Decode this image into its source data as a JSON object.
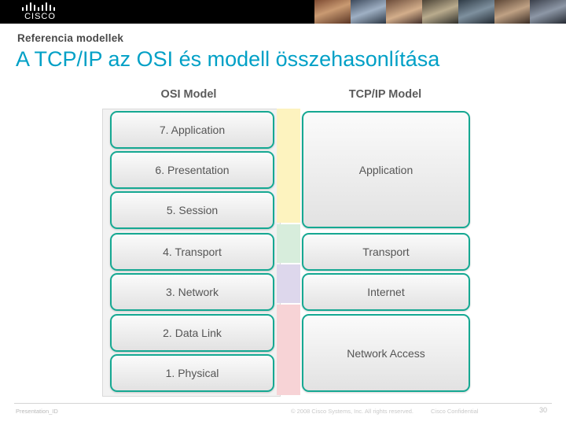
{
  "banner": {
    "logo_bars_icon": "cisco-bars-icon",
    "logo_word": "CISCO"
  },
  "slide": {
    "eyebrow": "Referencia modellek",
    "title": "A TCP/IP az OSI és modell összehasonlítása"
  },
  "diagram": {
    "osi_header": "OSI Model",
    "tcp_header": "TCP/IP Model",
    "osi_layers": [
      "7. Application",
      "6. Presentation",
      "5. Session",
      "4. Transport",
      "3. Network",
      "2. Data Link",
      "1. Physical"
    ],
    "tcp_layers": [
      "Application",
      "Transport",
      "Internet",
      "Network Access"
    ],
    "band_colors": {
      "application": "#fdf3bf",
      "transport": "#d7eddc",
      "internet": "#ddd7ec",
      "network_access": "#f7d3d6"
    },
    "layer_border_color": "#15a892"
  },
  "footer": {
    "left": "Presentation_ID",
    "copyright": "© 2008 Cisco Systems, Inc. All rights reserved.",
    "confidential": "Cisco Confidential",
    "page": "30"
  },
  "theme": {
    "title_color": "#00a0c6",
    "eyebrow_color": "#4a4a4a"
  }
}
